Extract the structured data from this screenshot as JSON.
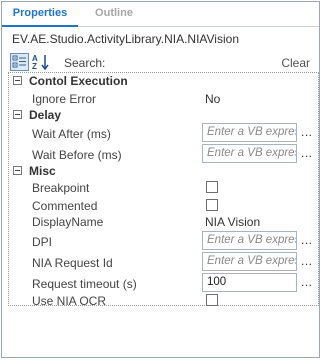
{
  "tabs": [
    {
      "label": "Properties",
      "active": true
    },
    {
      "label": "Outline",
      "active": false
    }
  ],
  "path": "EV.AE.Studio.ActivityLibrary.NIA.NIAVision",
  "toolbar": {
    "search_label": "Search:",
    "clear_label": "Clear",
    "categorized_icon": "categorized-icon",
    "sort_icon": "sort-az-icon"
  },
  "grid": {
    "categories": {
      "control_execution": {
        "label": "Contol Execution",
        "props": {
          "ignore_error": {
            "name": "Ignore Error",
            "value": "No"
          }
        }
      },
      "delay": {
        "label": "Delay",
        "props": {
          "wait_after": {
            "name": "Wait After (ms)",
            "placeholder": "Enter a VB expression"
          },
          "wait_before": {
            "name": "Wait Before (ms)",
            "placeholder": "Enter a VB expression"
          }
        }
      },
      "misc": {
        "label": "Misc",
        "props": {
          "breakpoint": {
            "name": "Breakpoint",
            "checked": false
          },
          "commented": {
            "name": "Commented",
            "checked": false
          },
          "display_name": {
            "name": "DisplayName",
            "value": "NIA Vision"
          },
          "dpi": {
            "name": "DPI",
            "placeholder": "Enter a VB expression"
          },
          "nia_request_id": {
            "name": "NIA Request Id",
            "placeholder": "Enter a VB expression"
          },
          "request_timeout": {
            "name": "Request timeout (s)",
            "value": "100"
          },
          "use_nia_ocr": {
            "name": "Use NIA OCR",
            "checked": false
          }
        }
      }
    },
    "ellipsis": "..."
  },
  "colors": {
    "accent": "#1f74c6",
    "border": "#9aa7b5",
    "placeholder": "#8a8a8a"
  }
}
